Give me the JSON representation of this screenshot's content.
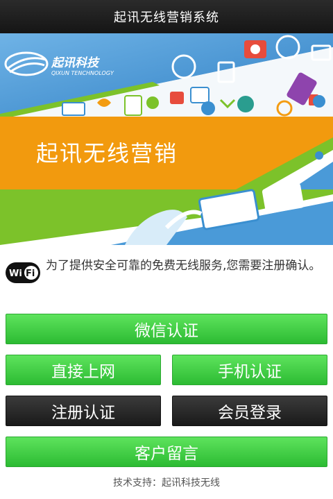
{
  "header": {
    "title": "起讯无线营销系统"
  },
  "banner": {
    "logo_text": "起讯科技",
    "logo_subtext": "QIXUN TENCHNOLOGY",
    "slogan": "起讯无线营销",
    "colors": {
      "blue": "#3a8fd0",
      "orange": "#f39c12",
      "green": "#7cc22a"
    }
  },
  "notice": {
    "badge_text": "Wi Fi",
    "text": "为了提供安全可靠的免费无线服务,您需要注册确认。"
  },
  "buttons": {
    "wechat": "微信认证",
    "direct": "直接上网",
    "phone": "手机认证",
    "register": "注册认证",
    "member": "会员登录",
    "message": "客户留言"
  },
  "footer": {
    "text": "技术支持：起讯科技无线"
  },
  "colors": {
    "green_button": "#3ccd3f",
    "dark_button": "#222222",
    "header_bg": "#1e1e1e"
  }
}
